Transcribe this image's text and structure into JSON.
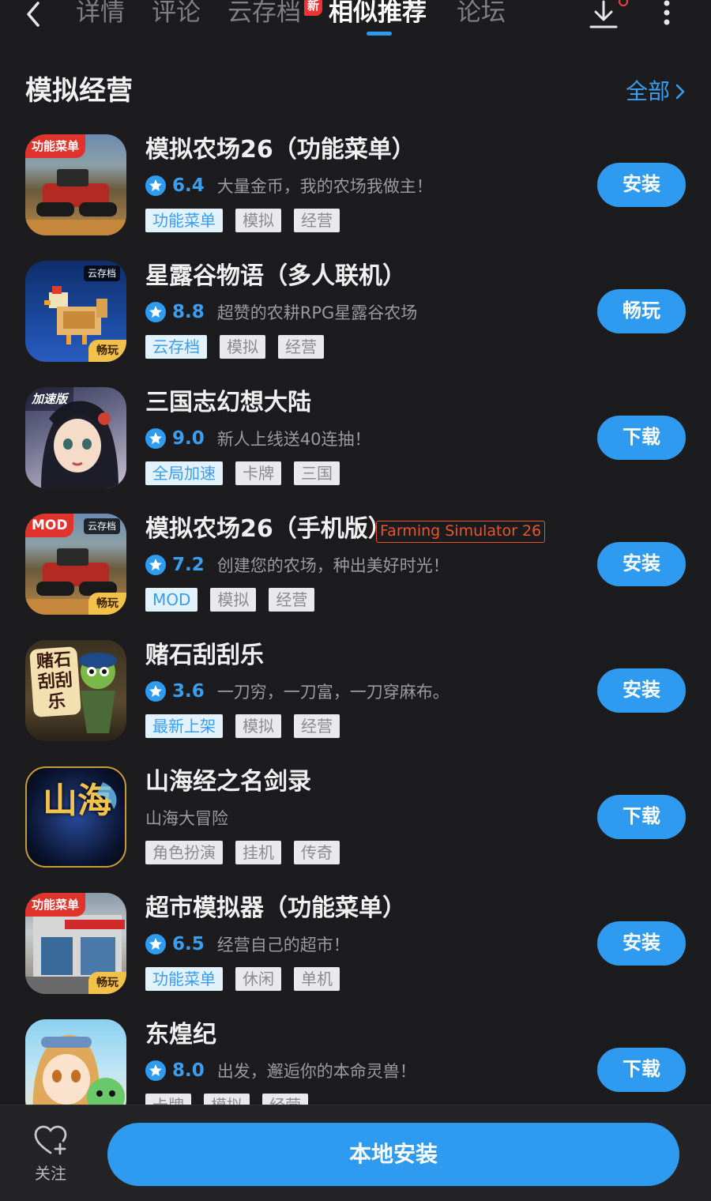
{
  "nav": {
    "tabs": [
      "详情",
      "评论",
      "云存档",
      "相似推荐",
      "论坛"
    ],
    "active_tab": "相似推荐",
    "new_badge": "新"
  },
  "section": {
    "title": "模拟经营",
    "all_link": "全部"
  },
  "apps": [
    {
      "name": "模拟农场26（功能菜单）",
      "score": "6.4",
      "desc": "大量金币，我的农场我做主！",
      "tags": [
        "功能菜单",
        "模拟",
        "经营"
      ],
      "button": "安装",
      "icon_corner_tl": "功能菜单"
    },
    {
      "name": "星露谷物语（多人联机）",
      "score": "8.8",
      "desc": "超赞的农耕RPG星露谷农场",
      "tags": [
        "云存档",
        "模拟",
        "经营"
      ],
      "button": "畅玩",
      "icon_corner_tr": "云存档",
      "icon_corner_br": "畅玩"
    },
    {
      "name": "三国志幻想大陆",
      "score": "9.0",
      "desc": "新人上线送40连抽！",
      "tags": [
        "全局加速",
        "卡牌",
        "三国"
      ],
      "button": "下载",
      "icon_corner_tl": "加速版"
    },
    {
      "name": "模拟农场26（手机版）",
      "en_tag": "Farming Simulator 26",
      "score": "7.2",
      "desc": "创建您的农场，种出美好时光！",
      "tags": [
        "MOD",
        "模拟",
        "经营"
      ],
      "button": "安装",
      "icon_corner_tl": "MOD",
      "icon_corner_tr": "云存档",
      "icon_corner_br": "畅玩"
    },
    {
      "name": "赌石刮刮乐",
      "score": "3.6",
      "desc": "一刀穷，一刀富，一刀穿麻布。",
      "tags": [
        "最新上架",
        "模拟",
        "经营"
      ],
      "button": "安装",
      "icon_text": "赌石刮刮乐"
    },
    {
      "name": "山海经之名剑录",
      "desc": "山海大冒险",
      "tags": [
        "角色扮演",
        "挂机",
        "传奇"
      ],
      "button": "下载",
      "icon_text": "山海"
    },
    {
      "name": "超市模拟器（功能菜单）",
      "score": "6.5",
      "desc": "经营自己的超市！",
      "tags": [
        "功能菜单",
        "休闲",
        "单机"
      ],
      "button": "安装",
      "icon_corner_tl": "功能菜单",
      "icon_corner_br": "畅玩"
    },
    {
      "name": "东煌纪",
      "score": "8.0",
      "desc": "出发，邂逅你的本命灵兽！",
      "tags": [
        "卡牌",
        "模拟",
        "经营"
      ],
      "button": "下载"
    }
  ],
  "bottom": {
    "follow_label": "关注",
    "install_label": "本地安装"
  },
  "colors": {
    "accent": "#2f9bf0",
    "background": "#1c1c1e",
    "badge_red": "#f03434"
  }
}
